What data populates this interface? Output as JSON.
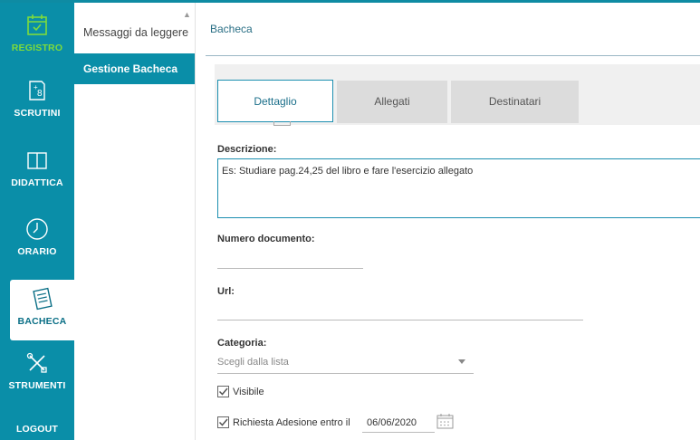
{
  "nav": {
    "items": [
      {
        "label": "REGISTRO",
        "icon": "calendar-check-icon"
      },
      {
        "label": "SCRUTINI",
        "icon": "grades-icon"
      },
      {
        "label": "DIDATTICA",
        "icon": "book-icon"
      },
      {
        "label": "ORARIO",
        "icon": "clock-icon"
      },
      {
        "label": "BACHECA",
        "icon": "notes-icon"
      },
      {
        "label": "STRUMENTI",
        "icon": "tools-icon"
      },
      {
        "label": "LOGOUT",
        "icon": ""
      }
    ],
    "active": "BACHECA"
  },
  "submenu": {
    "items": [
      {
        "label": "Messaggi da leggere"
      },
      {
        "label": "Gestione Bacheca"
      }
    ]
  },
  "breadcrumb": "Bacheca",
  "tabs": [
    {
      "label": "Dettaglio"
    },
    {
      "label": "Allegati"
    },
    {
      "label": "Destinatari"
    }
  ],
  "form": {
    "descrizione_label": "Descrizione:",
    "descrizione_value": "Es: Studiare pag.24,25 del libro e fare l'esercizio allegato",
    "numero_label": "Numero documento:",
    "numero_value": "",
    "url_label": "Url:",
    "url_value": "",
    "categoria_label": "Categoria:",
    "categoria_placeholder": "Scegli dalla lista",
    "visibile_label": "Visibile",
    "adesione_label": "Richiesta Adesione entro il",
    "adesione_date": "06/06/2020"
  },
  "colors": {
    "rail": "#0a8ea8",
    "accent": "#1c8fb0",
    "registro": "#7ddb3c"
  }
}
